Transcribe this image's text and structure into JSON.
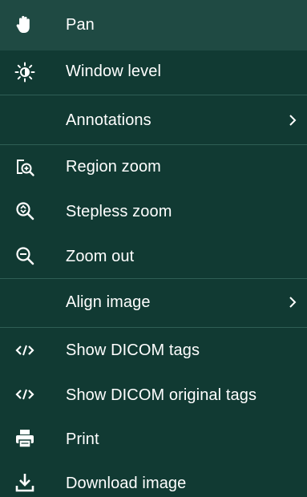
{
  "menu": {
    "items": [
      {
        "label": "Pan",
        "icon": "hand-icon"
      },
      {
        "label": "Window level",
        "icon": "sun-icon"
      },
      {
        "label": "Annotations",
        "icon": "",
        "submenu": true
      },
      {
        "label": "Region zoom",
        "icon": "region-zoom-icon"
      },
      {
        "label": "Stepless zoom",
        "icon": "stepless-zoom-icon"
      },
      {
        "label": "Zoom out",
        "icon": "zoom-out-icon"
      },
      {
        "label": "Align image",
        "icon": "",
        "submenu": true
      },
      {
        "label": "Show DICOM tags",
        "icon": "code-icon"
      },
      {
        "label": "Show DICOM original tags",
        "icon": "code-icon"
      },
      {
        "label": "Print",
        "icon": "printer-icon"
      },
      {
        "label": "Download image",
        "icon": "download-icon"
      }
    ]
  },
  "colors": {
    "background": "#113a33",
    "hover": "#1f4a43",
    "divider": "#2f5e55",
    "text": "#ffffff"
  }
}
